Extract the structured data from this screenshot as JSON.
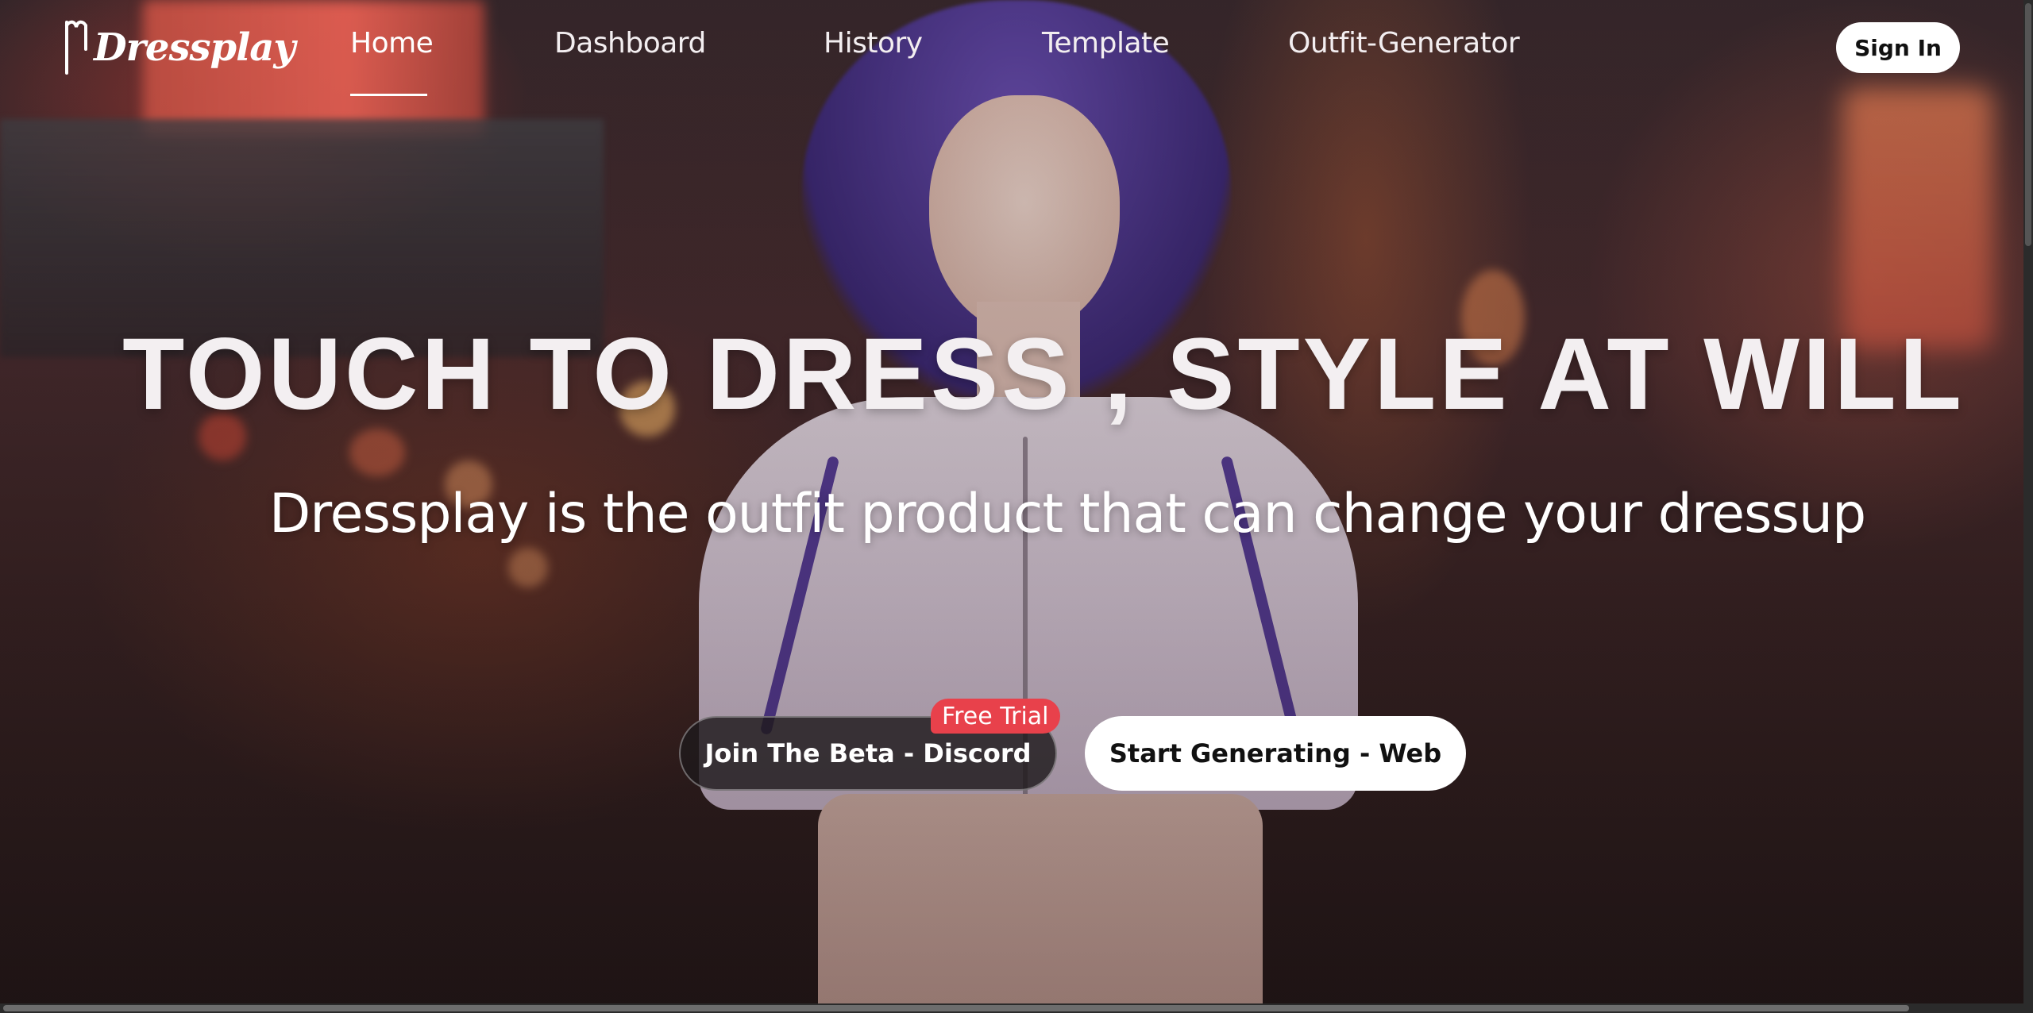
{
  "brand": {
    "name": "Dressplay",
    "logo_icon": "hanger-figure-icon"
  },
  "nav": {
    "items": [
      {
        "label": "Home",
        "active": true
      },
      {
        "label": "Dashboard",
        "active": false
      },
      {
        "label": "History",
        "active": false
      },
      {
        "label": "Template",
        "active": false
      },
      {
        "label": "Outfit-Generator",
        "active": false
      }
    ],
    "sign_in_label": "Sign In"
  },
  "hero": {
    "headline": "TOUCH TO DRESS , STYLE AT WILL",
    "subheadline": "Dressplay is the outfit product that can change your dressup",
    "discord_button_label": "Join The Beta - Discord",
    "badge_label": "Free Trial",
    "web_button_label": "Start Generating - Web"
  },
  "colors": {
    "badge": "#e8414b",
    "primary_button_bg": "#ffffff",
    "secondary_button_bg": "#1e1a1c",
    "text": "#ffffff"
  }
}
